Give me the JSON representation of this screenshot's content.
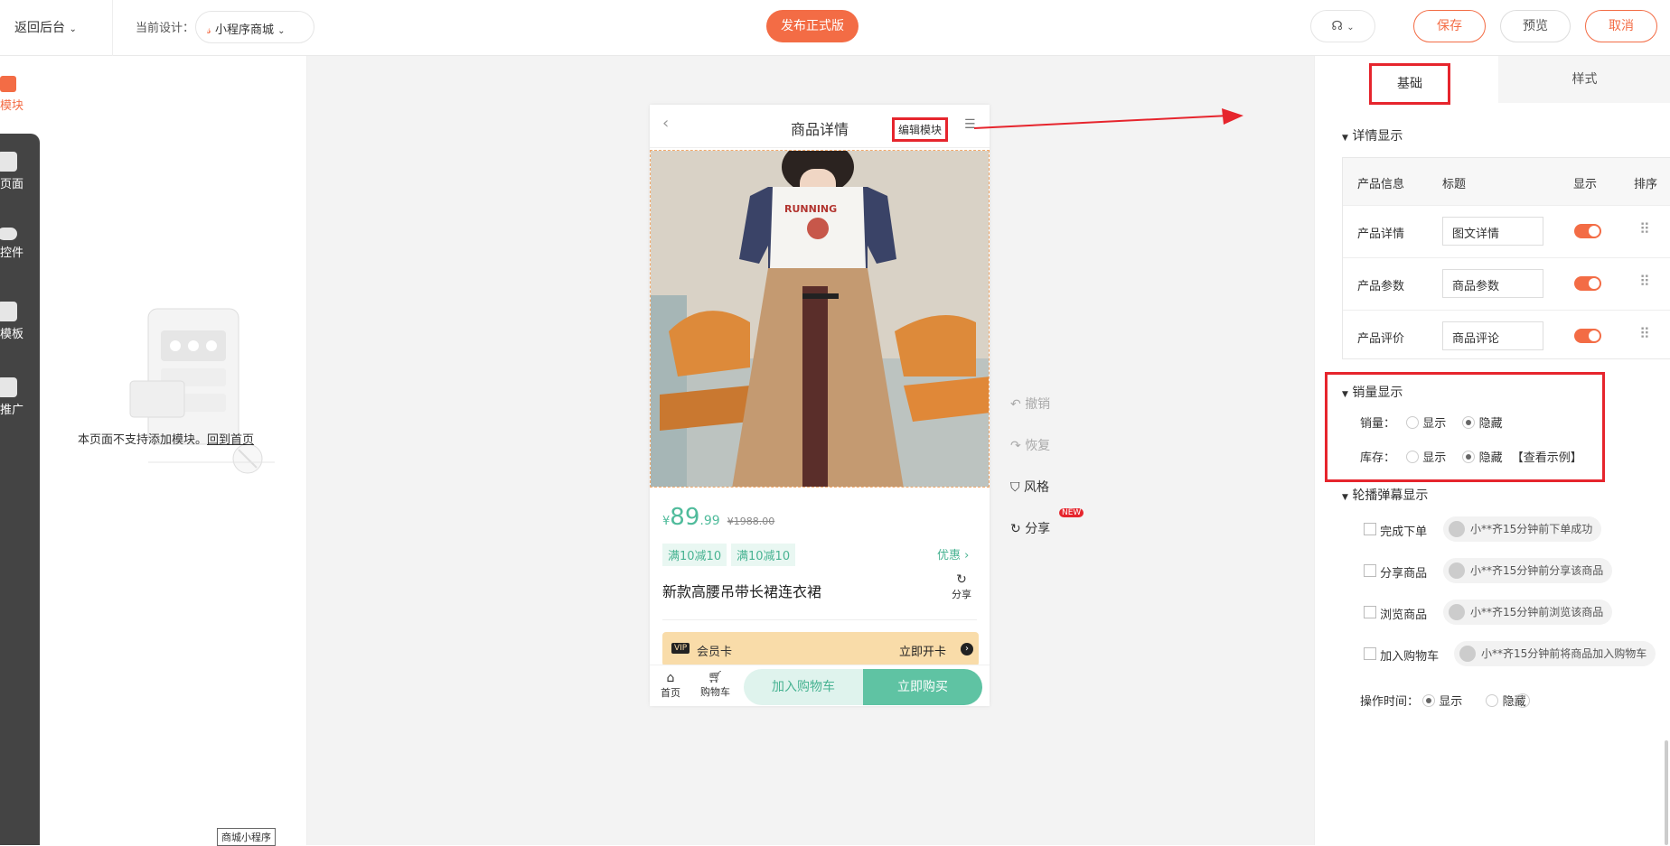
{
  "topbar": {
    "back_label": "返回后台",
    "current_design_label": "当前设计：",
    "design_select_value": "小程序商城",
    "publish_label": "发布正式版",
    "save_label": "保存",
    "preview_label": "预览",
    "cancel_label": "取消"
  },
  "rail": {
    "items": [
      {
        "label": "模块",
        "icon": "module-icon"
      },
      {
        "label": "页面",
        "icon": "page-icon"
      },
      {
        "label": "控件",
        "icon": "widget-icon"
      },
      {
        "label": "模板",
        "icon": "template-icon"
      },
      {
        "label": "推广",
        "icon": "promote-icon"
      }
    ]
  },
  "leftpanel": {
    "empty_text": "本页面不支持添加模块。",
    "back_home_link": "回到首页",
    "tag": "商城小程序"
  },
  "phone": {
    "title": "商品详情",
    "edit_module_label": "编辑模块",
    "currency": "¥",
    "price_int": "89",
    "price_dec": ".99",
    "old_price": "¥1988.00",
    "tags": [
      "满10减10",
      "满10减10"
    ],
    "promo_link": "优惠",
    "product_name": "新款高腰吊带长裙连衣裙",
    "share_label": "分享",
    "vip_badge": "VIP",
    "vip_label": "会员卡",
    "vip_action": "立即开卡",
    "nav_home": "首页",
    "nav_cart": "购物车",
    "add_cart": "加入购物车",
    "buy_now": "立即购买",
    "shirt_text": "RUNNING"
  },
  "tools": {
    "undo": "撤销",
    "redo": "恢复",
    "style": "风格",
    "share": "分享",
    "new_badge": "NEW"
  },
  "rpanel": {
    "tab_basic": "基础",
    "tab_style": "样式",
    "detail_section": "详情显示",
    "table_headers": [
      "产品信息",
      "标题",
      "显示",
      "排序"
    ],
    "rows": [
      {
        "name": "产品详情",
        "title": "图文详情"
      },
      {
        "name": "产品参数",
        "title": "商品参数"
      },
      {
        "name": "产品评价",
        "title": "商品评论"
      }
    ],
    "sales_section": "销量显示",
    "sales_label": "销量：",
    "stock_label": "库存：",
    "show": "显示",
    "hide": "隐藏",
    "view_example": "【查看示例】",
    "carousel_section": "轮播弹幕显示",
    "carousel_items": [
      {
        "label": "完成下单",
        "text": "小**齐15分钟前下单成功"
      },
      {
        "label": "分享商品",
        "text": "小**齐15分钟前分享该商品"
      },
      {
        "label": "浏览商品",
        "text": "小**齐15分钟前浏览该商品"
      },
      {
        "label": "加入购物车",
        "text": "小**齐15分钟前将商品加入购物车"
      }
    ],
    "op_time_label": "操作时间：",
    "help": "?"
  },
  "colors": {
    "accent": "#f36c45",
    "green": "#5fc3a3",
    "annotation_red": "#e6252d"
  }
}
